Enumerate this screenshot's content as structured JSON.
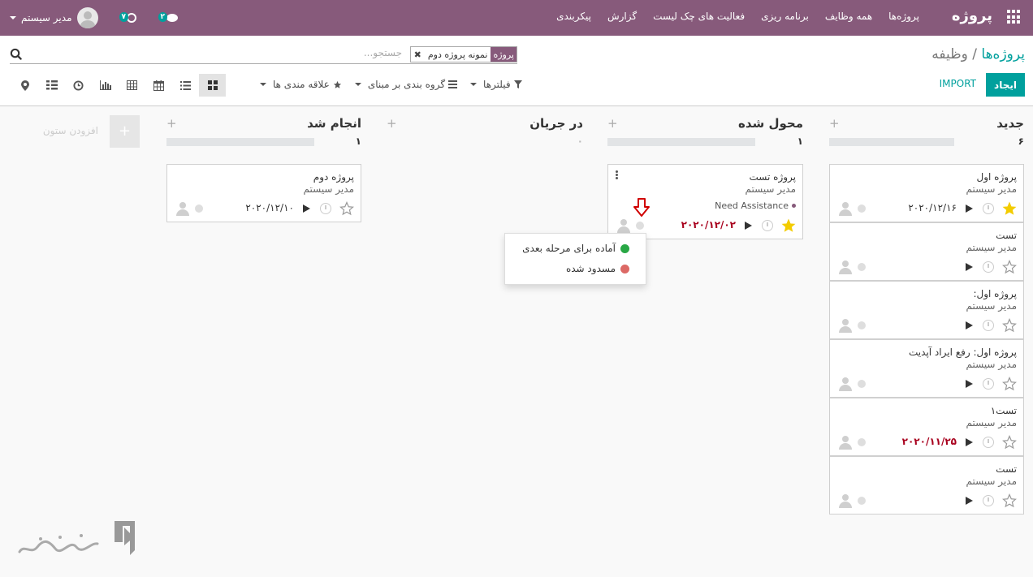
{
  "navbar": {
    "brand": "پروژه",
    "menu": [
      "پروژه‌ها",
      "همه وظایف",
      "برنامه ریزی",
      "فعالیت های چک لیست",
      "گزارش",
      "پیکربندی"
    ],
    "user_name": "مدیر سیستم",
    "activity_badge": "۷",
    "messages_badge": "۲",
    "bg_color": "#875a7b"
  },
  "breadcrumb": {
    "parent": "پروژه‌ها",
    "separator": "/",
    "current": "وظیفه"
  },
  "search": {
    "placeholder": "جستجو...",
    "facet_category": "پروژه",
    "facet_value": "نمونه پروژه دوم",
    "facet_remove": "✖"
  },
  "buttons": {
    "create": "ایجاد",
    "import": "IMPORT"
  },
  "filters": {
    "filters_label": "فیلترها",
    "groupby_label": "گروه بندی بر مبنای",
    "favorites_label": "علاقه مندی ها"
  },
  "views": [
    "kanban",
    "list",
    "calendar",
    "pivot",
    "graph",
    "activity",
    "gantt",
    "map"
  ],
  "columns": [
    {
      "title": "جدید",
      "count": "۶",
      "cards": [
        {
          "title": "پروژه اول",
          "user": "مدیر سیستم",
          "deadline": "۲۰۲۰/۱۲/۱۶",
          "deadline_overdue": false,
          "starred": true
        },
        {
          "title": "تست",
          "user": "مدیر سیستم",
          "deadline": "",
          "deadline_overdue": false,
          "starred": false
        },
        {
          "title": "پروژه اول:",
          "user": "مدیر سیستم",
          "deadline": "",
          "deadline_overdue": false,
          "starred": false
        },
        {
          "title": "پروژه اول: رفع ایراد آپدیت",
          "user": "مدیر سیستم",
          "deadline": "",
          "deadline_overdue": false,
          "starred": false
        },
        {
          "title": "تست۱",
          "user": "مدیر سیستم",
          "deadline": "۲۰۲۰/۱۱/۲۵",
          "deadline_overdue": true,
          "starred": false
        },
        {
          "title": "تست",
          "user": "مدیر سیستم",
          "deadline": "",
          "deadline_overdue": false,
          "starred": false
        }
      ]
    },
    {
      "title": "محول شده",
      "count": "۱",
      "cards": [
        {
          "title": "پروژه تست",
          "user": "مدیر سیستم",
          "tag": "Need Assistance",
          "deadline": "۲۰۲۰/۱۲/۰۲",
          "deadline_overdue": true,
          "starred": true
        }
      ]
    },
    {
      "title": "در جریان",
      "count": "۰",
      "cards": []
    },
    {
      "title": "انجام شد",
      "count": "۱",
      "cards": [
        {
          "title": "پروژه دوم",
          "user": "مدیر سیستم",
          "deadline": "۲۰۲۰/۱۲/۱۰",
          "deadline_overdue": false,
          "starred": false
        }
      ]
    }
  ],
  "add_column": {
    "plus": "+",
    "label": "افزودن ستون"
  },
  "plus_sign": "+",
  "status_menu": [
    {
      "label": "آماده برای مرحله بعدی",
      "color": "#28a745"
    },
    {
      "label": "مسدود شده",
      "color": "#dc6965"
    }
  ],
  "colors": {
    "accent": "#00a09d",
    "brand": "#875a7b",
    "overdue": "#a8001d",
    "star": "#f3cc00"
  }
}
